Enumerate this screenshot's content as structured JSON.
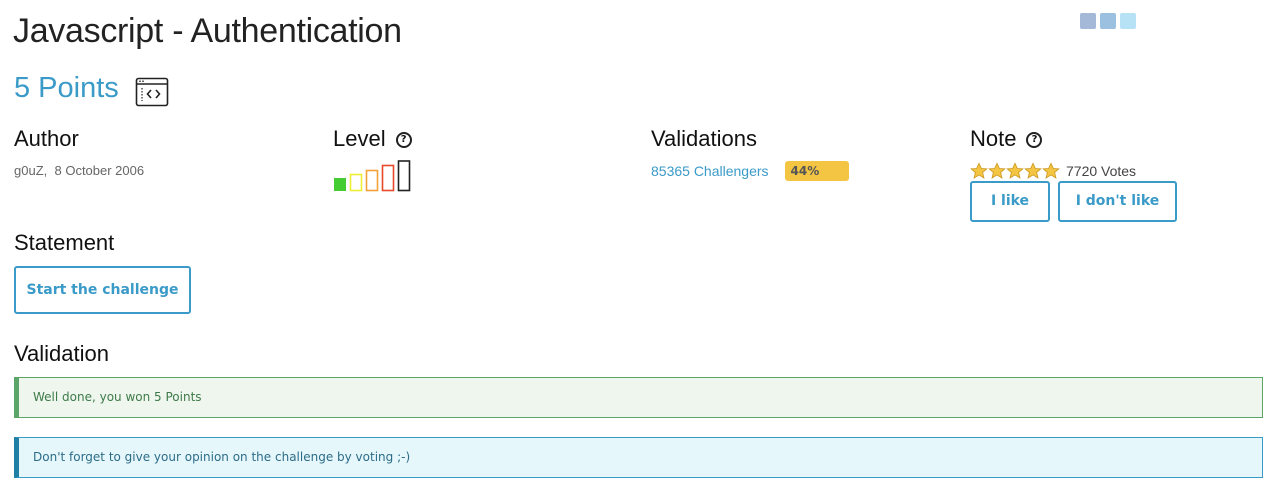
{
  "title": "Javascript - Authentication",
  "points": "5 Points",
  "challenge_type_icon": "browser-code-icon",
  "social": {
    "icons": [
      "facebook-icon",
      "linkedin-icon",
      "twitter-icon"
    ]
  },
  "author": {
    "heading": "Author",
    "name": "g0uZ",
    "date": "8 October 2006"
  },
  "level": {
    "heading": "Level",
    "help_icon": "help-circle-icon",
    "current_level": 1,
    "max_level": 5,
    "colors": [
      "#44cc33",
      "#eeee33",
      "#f3a23a",
      "#e84a2a",
      "#222222"
    ]
  },
  "validations": {
    "heading": "Validations",
    "challengers": "85365 Challengers",
    "percent": "44%"
  },
  "note": {
    "heading": "Note",
    "help_icon": "help-circle-icon",
    "stars": 5,
    "votes": "7720 Votes",
    "like_label": "I like",
    "dislike_label": "I don't like"
  },
  "statement": {
    "heading": "Statement",
    "start_label": "Start the challenge"
  },
  "validation": {
    "heading": "Validation",
    "success_message": "Well done, you won 5 Points",
    "info_message": "Don't forget to give your opinion on the challenge by voting ;-)"
  },
  "colors": {
    "accent": "#3a9ac8",
    "progress": "#f4c542",
    "success": "#5aa567",
    "info": "#1f7fa5"
  }
}
